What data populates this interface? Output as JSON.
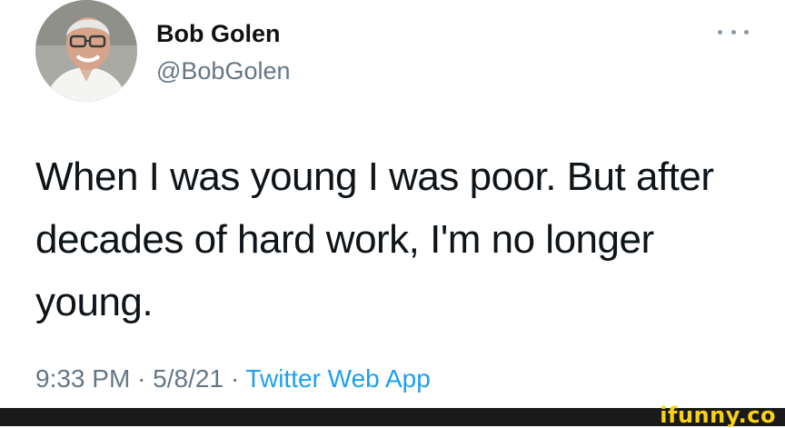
{
  "tweet": {
    "author": {
      "name": "Bob Golen",
      "handle": "@BobGolen"
    },
    "more_icon": "more-horizontal-icon",
    "text": "When I was young I was poor.  But after decades of hard work, I'm no longer young.",
    "meta": {
      "time": "9:33 PM",
      "separator": "·",
      "date": "5/8/21",
      "source": "Twitter Web App"
    }
  },
  "watermark": {
    "text": "ifunny.co",
    "color": "#f9d215"
  },
  "colors": {
    "handle": "#657786",
    "source_link": "#1da1f2"
  }
}
